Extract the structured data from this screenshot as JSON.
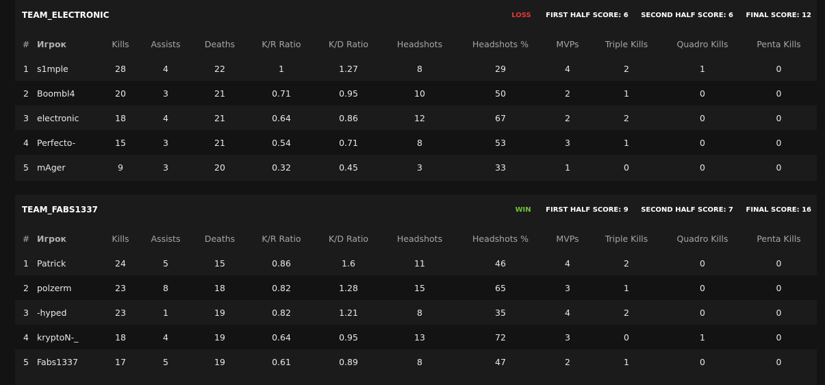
{
  "columns": [
    "#",
    "Игрок",
    "Kills",
    "Assists",
    "Deaths",
    "K/R Ratio",
    "K/D Ratio",
    "Headshots",
    "Headshots %",
    "MVPs",
    "Triple Kills",
    "Quadro Kills",
    "Penta Kills"
  ],
  "colors": {
    "loss": "#e03a3a",
    "win": "#6fc23a",
    "panel": "#1b1b1b",
    "background": "#131313"
  },
  "teams": [
    {
      "name": "TEAM_ELECTRONIC",
      "result": "LOSS",
      "first_half": "FIRST HALF SCORE: 6",
      "second_half": "SECOND HALF SCORE: 6",
      "final": "FINAL SCORE: 12",
      "players": [
        [
          "1",
          "s1mple",
          "28",
          "4",
          "22",
          "1",
          "1.27",
          "8",
          "29",
          "4",
          "2",
          "1",
          "0"
        ],
        [
          "2",
          "Boombl4",
          "20",
          "3",
          "21",
          "0.71",
          "0.95",
          "10",
          "50",
          "2",
          "1",
          "0",
          "0"
        ],
        [
          "3",
          "electronic",
          "18",
          "4",
          "21",
          "0.64",
          "0.86",
          "12",
          "67",
          "2",
          "2",
          "0",
          "0"
        ],
        [
          "4",
          "Perfecto-",
          "15",
          "3",
          "21",
          "0.54",
          "0.71",
          "8",
          "53",
          "3",
          "1",
          "0",
          "0"
        ],
        [
          "5",
          "mAger",
          "9",
          "3",
          "20",
          "0.32",
          "0.45",
          "3",
          "33",
          "1",
          "0",
          "0",
          "0"
        ]
      ]
    },
    {
      "name": "TEAM_FABS1337",
      "result": "WIN",
      "first_half": "FIRST HALF SCORE: 9",
      "second_half": "SECOND HALF SCORE: 7",
      "final": "FINAL SCORE: 16",
      "players": [
        [
          "1",
          "Patrick",
          "24",
          "5",
          "15",
          "0.86",
          "1.6",
          "11",
          "46",
          "4",
          "2",
          "0",
          "0"
        ],
        [
          "2",
          "polzerm",
          "23",
          "8",
          "18",
          "0.82",
          "1.28",
          "15",
          "65",
          "3",
          "1",
          "0",
          "0"
        ],
        [
          "3",
          "-hyped",
          "23",
          "1",
          "19",
          "0.82",
          "1.21",
          "8",
          "35",
          "4",
          "2",
          "0",
          "0"
        ],
        [
          "4",
          "kryptoN-_",
          "18",
          "4",
          "19",
          "0.64",
          "0.95",
          "13",
          "72",
          "3",
          "0",
          "1",
          "0"
        ],
        [
          "5",
          "Fabs1337",
          "17",
          "5",
          "19",
          "0.61",
          "0.89",
          "8",
          "47",
          "2",
          "1",
          "0",
          "0"
        ]
      ]
    }
  ]
}
